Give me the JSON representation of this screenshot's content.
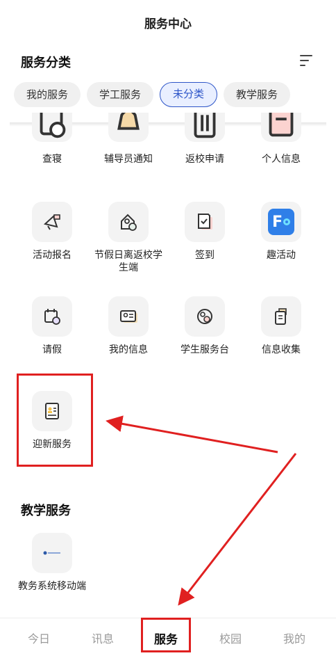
{
  "header": {
    "title": "服务中心"
  },
  "category": {
    "heading": "服务分类",
    "tabs": [
      {
        "label": "我的服务",
        "active": false
      },
      {
        "label": "学工服务",
        "active": false
      },
      {
        "label": "未分类",
        "active": true
      },
      {
        "label": "教学服务",
        "active": false
      }
    ]
  },
  "services_partial": [
    {
      "label": "查寝",
      "icon": "dorm-check-icon"
    },
    {
      "label": "辅导员通知",
      "icon": "bell-icon"
    },
    {
      "label": "返校申请",
      "icon": "luggage-icon"
    },
    {
      "label": "个人信息",
      "icon": "profile-doc-icon"
    }
  ],
  "services": [
    {
      "label": "活动报名",
      "icon": "megaphone-icon"
    },
    {
      "label": "节假日离返校学生端",
      "icon": "home-return-icon"
    },
    {
      "label": "签到",
      "icon": "checkin-doc-icon"
    },
    {
      "label": "趣活动",
      "icon": "fun-activity-logo",
      "logo_text": "F"
    },
    {
      "label": "请假",
      "icon": "calendar-clock-icon"
    },
    {
      "label": "我的信息",
      "icon": "id-card-icon"
    },
    {
      "label": "学生服务台",
      "icon": "service-desk-icon"
    },
    {
      "label": "信息收集",
      "icon": "clipboard-icon"
    },
    {
      "label": "迎新服务",
      "icon": "welcome-card-icon"
    }
  ],
  "teaching": {
    "heading": "教学服务",
    "items": [
      {
        "label": "教务系统移动端",
        "icon": "academic-system-logo"
      }
    ]
  },
  "bottom_nav": [
    {
      "label": "今日",
      "active": false
    },
    {
      "label": "讯息",
      "active": false
    },
    {
      "label": "服务",
      "active": true
    },
    {
      "label": "校园",
      "active": false
    },
    {
      "label": "我的",
      "active": false
    }
  ],
  "colors": {
    "accent": "#2d55c8",
    "highlight": "#e02020",
    "tab_bg": "#f0f0f0",
    "active_tab_bg": "#e9efff"
  }
}
